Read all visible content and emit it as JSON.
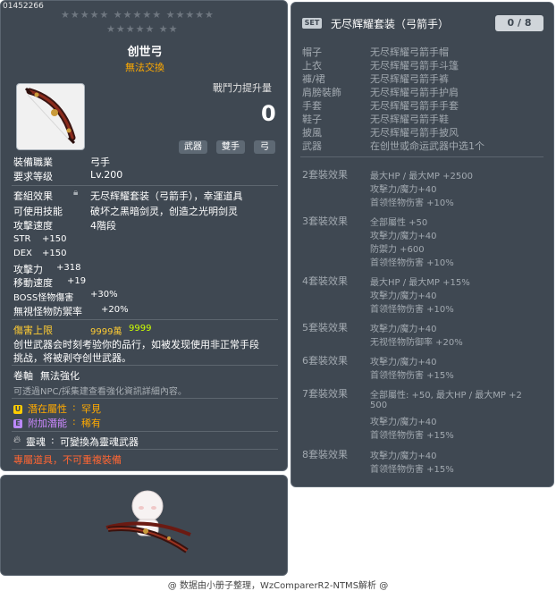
{
  "item": {
    "code": "01452266",
    "stars_row1": "★★★★★  ★★★★★  ★★★★★",
    "stars_row2": "★★★★★  ★★",
    "name": "创世弓",
    "untradeable": "無法交換",
    "cp_label": "戰鬥力提升量",
    "cp_value": "0",
    "tags": [
      "武器",
      "雙手",
      "弓"
    ],
    "job_label": "裝備職業",
    "job_value": "弓手",
    "level_label": "要求等级",
    "level_value": "Lv.200"
  },
  "details": {
    "set_label": "套組效果",
    "set_value": "无尽辉耀套装（弓箭手），幸運道具",
    "skill_label": "可使用技能",
    "skill_value": "破坏之黑暗剑灵，创造之光明剑灵",
    "speed_label": "攻擊速度",
    "speed_value": "4階段",
    "stats": [
      {
        "label": "STR",
        "value": "+150"
      },
      {
        "label": "DEX",
        "value": "+150"
      },
      {
        "label": "攻擊力",
        "value": "+318"
      },
      {
        "label": "移動速度",
        "value": "+19"
      },
      {
        "label": "BOSS怪物傷害",
        "value": "+30%"
      },
      {
        "label": "無視怪物防禦率",
        "value": "+20%"
      }
    ],
    "dmg_cap_label": "傷害上限",
    "dmg_cap_value1": "9999萬",
    "dmg_cap_value2": "9999",
    "desc1": "创世武器会时刻考验你的品行，如被发现使用非正常手段",
    "desc2": "挑战，将被剥夺创世武器。",
    "scroll_label": "卷軸",
    "scroll_value": "無法強化",
    "npc_note": "可透過NPC/採集建查看強化資訊詳細內容。",
    "potential_badge": "U",
    "potential_label": "潛在屬性",
    "potential_value": "罕見",
    "bonus_badge": "E",
    "bonus_label": "附加潛能",
    "bonus_value": "稀有",
    "soul_label": "靈魂",
    "soul_value": "可變換為靈魂武器",
    "exclusive": "專屬道具，不可重複裝備"
  },
  "set": {
    "badge": "SET",
    "name": "无尽辉耀套装（弓箭手）",
    "count": "0 / 8",
    "parts": [
      {
        "slot": "帽子",
        "item": "无尽辉耀弓箭手帽"
      },
      {
        "slot": "上衣",
        "item": "无尽辉耀弓箭手斗篷"
      },
      {
        "slot": "褲/裙",
        "item": "无尽辉耀弓箭手裤"
      },
      {
        "slot": "肩膀裝飾",
        "item": "无尽辉耀弓箭手护肩"
      },
      {
        "slot": "手套",
        "item": "无尽辉耀弓箭手手套"
      },
      {
        "slot": "鞋子",
        "item": "无尽辉耀弓箭手鞋"
      },
      {
        "slot": "披風",
        "item": "无尽辉耀弓箭手披风"
      },
      {
        "slot": "武器",
        "item": "在创世或命运武器中选1个"
      }
    ],
    "effects": [
      {
        "label": "2套裝效果",
        "lines": [
          "最大HP / 最大MP  +2500",
          "攻擊力/魔力+40",
          "首领怪物伤害 +10%"
        ]
      },
      {
        "label": "3套裝效果",
        "lines": [
          "全部屬性 +50",
          "攻擊力/魔力+40",
          "防禦力 +600",
          "首领怪物伤害 +10%"
        ]
      },
      {
        "label": "4套裝效果",
        "lines": [
          "最大HP / 最大MP  +15%",
          "攻擊力/魔力+40",
          "首领怪物伤害 +10%"
        ]
      },
      {
        "label": "5套裝效果",
        "lines": [
          "攻擊力/魔力+40",
          "无视怪物防御率 +20%"
        ]
      },
      {
        "label": "6套裝效果",
        "lines": [
          "攻擊力/魔力+40",
          "首领怪物伤害 +15%"
        ]
      },
      {
        "label": "7套裝效果",
        "lines": [
          "全部屬性: +50, 最大HP / 最大MP  +2",
          "500",
          "攻擊力/魔力+40",
          "首领怪物伤害 +15%"
        ]
      },
      {
        "label": "8套裝效果",
        "lines": [
          "攻擊力/魔力+40",
          "首领怪物伤害 +15%"
        ]
      }
    ]
  },
  "footer": "@ 数据由小册子整理，WzComparerR2-NTMS解析 @",
  "colors": {
    "panel": "#3f4852",
    "title_orange": "#ffaa00",
    "damage_cap_yellow": "#ffcc33",
    "damage_cap_lime": "#ccff00",
    "exclusive_red": "#ff6633",
    "set_gray": "#a2a9b0"
  },
  "icons": [
    "bow-icon",
    "set-badge-icon",
    "potential-badge-icon",
    "bonus-badge-icon",
    "soul-flame-icon",
    "character-preview-icon"
  ]
}
